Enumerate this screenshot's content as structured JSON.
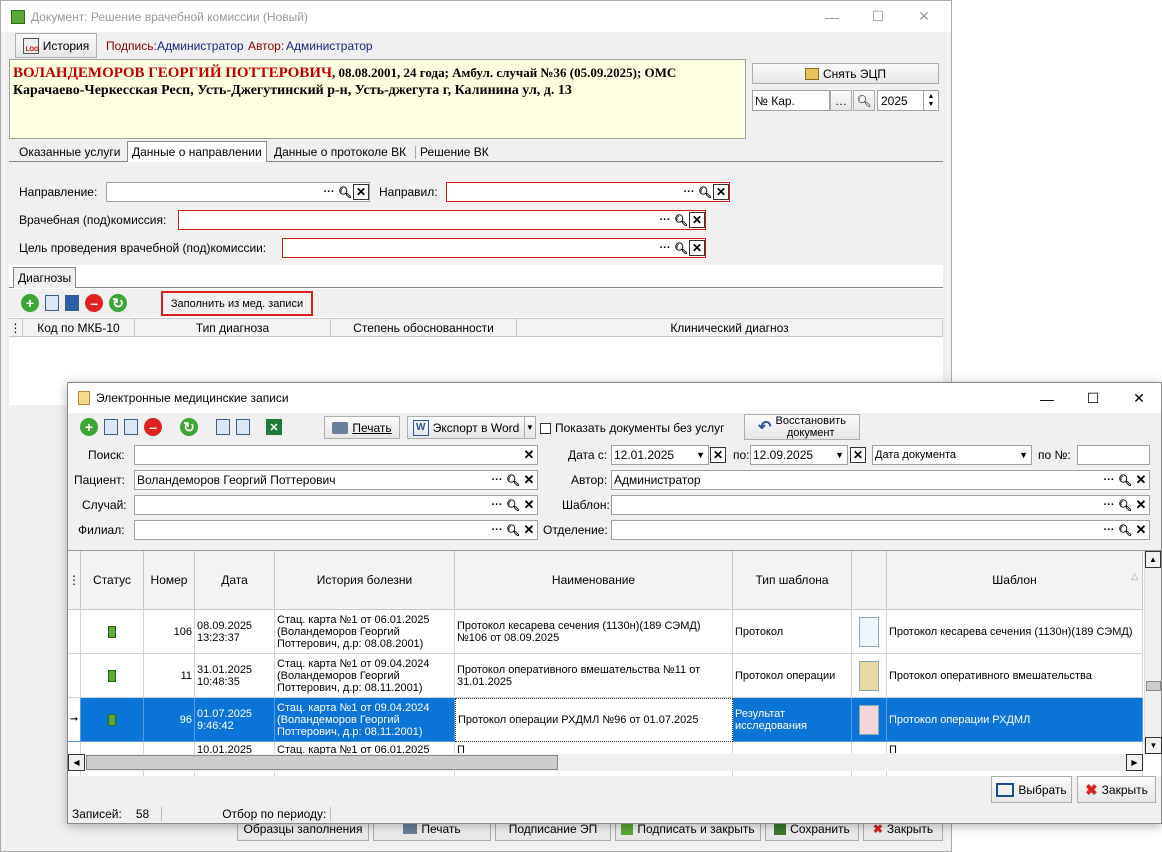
{
  "main_window": {
    "title": "Документ: Решение врачебной комиссии (Новый)",
    "history_button": "История",
    "signature_label": "Подпись:",
    "signature_value": "Администратор",
    "author_label": "Автор:",
    "author_value": "Администратор",
    "patient_name": "ВОЛАНДЕМОРОВ ГЕОРГИЙ ПОТТЕРОВИЧ",
    "patient_info": ", 08.08.2001, 24 года; Амбул. случай №36 (05.09.2025); ОМС",
    "patient_address": "Карачаево-Черкесская Респ, Усть-Джегутинский р-н, Усть-джегута г, Калинина ул, д. 13",
    "remove_ecp_button": "Снять ЭЦП",
    "card_number_placeholder": "№ Кар.",
    "year_value": "2025",
    "tabs": [
      "Оказанные услуги",
      "Данные о направлении",
      "Данные о протоколе ВК",
      "Решение ВК"
    ],
    "direction_label": "Направление:",
    "directed_by_label": "Направил:",
    "commission_label": "Врачебная (под)комиссия:",
    "purpose_label": "Цель проведения врачебной (под)комиссии:",
    "diagnoses_tab": "Диагнозы",
    "fill_from_record_button": "Заполнить из мед. записи",
    "diag_columns": [
      "Код по МКБ-10",
      "Тип диагноза",
      "Степень обоснованности",
      "Клинический диагноз"
    ],
    "bottom_buttons": [
      "Образцы заполнения",
      "Печать",
      "Подписание ЭП",
      "Подписать и закрыть",
      "Сохранить",
      "Закрыть"
    ]
  },
  "emr_dialog": {
    "title": "Электронные медицинские записи",
    "print_button": "Печать",
    "export_word_button": "Экспорт в Word",
    "show_without_services_label": "Показать документы без услуг",
    "restore_button_line1": "Восстановить",
    "restore_button_line2": "документ",
    "search_label": "Поиск:",
    "date_from_label": "Дата с:",
    "date_from_value": "12.01.2025",
    "date_to_label": "по:",
    "date_to_value": "12.09.2025",
    "date_type_value": "Дата документа",
    "number_label": "по №:",
    "patient_label": "Пациент:",
    "patient_value": "Воландеморов Георгий Поттерович",
    "author_label": "Автор:",
    "author_value": "Администратор",
    "case_label": "Случай:",
    "template_label": "Шаблон:",
    "branch_label": "Филиал:",
    "department_label": "Отделение:",
    "columns": [
      "Статус",
      "Номер",
      "Дата",
      "История болезни",
      "Наименование",
      "Тип шаблона",
      "",
      "Шаблон"
    ],
    "rows": [
      {
        "number": "106",
        "date": "08.09.2025",
        "time": "13:23:37",
        "history1": "Стац. карта №1 от 06.01.2025",
        "history2": "(Воландеморов Георгий",
        "history3": "Поттерович, д.р: 08.08.2001)",
        "name": "Протокол кесарева сечения (1130н)(189 СЭМД) №106 от 08.09.2025",
        "template_type": "Протокол",
        "template": "Протокол кесарева сечения (1130н)(189 СЭМД)"
      },
      {
        "number": "11",
        "date": "31.01.2025",
        "time": "10:48:35",
        "history1": "Стац. карта №1 от 09.04.2024",
        "history2": "(Воландеморов Георгий",
        "history3": "Поттерович, д.р: 08.11.2001)",
        "name": "Протокол оперативного вмешательства №11 от 31.01.2025",
        "template_type": "Протокол операции",
        "template": "Протокол оперативного вмешательства"
      },
      {
        "number": "96",
        "date": "01.07.2025",
        "time": "9:46:42",
        "history1": "Стац. карта №1 от 09.04.2024",
        "history2": "(Воландеморов Георгий",
        "history3": "Поттерович, д.р: 08.11.2001)",
        "name": "Протокол операции РХДМЛ №96 от 01.07.2025",
        "template_type": "Результат исследования",
        "template": "Протокол операции РХДМЛ"
      },
      {
        "number": "",
        "date": "10.01.2025",
        "time": "",
        "history1": "Стац. карта №1 от 06.01.2025",
        "history2": "",
        "history3": "",
        "name": "П",
        "template_type": "",
        "template": "П"
      }
    ],
    "select_button": "Выбрать",
    "close_button": "Закрыть",
    "records_label": "Записей:",
    "records_count": "58",
    "period_filter_label": "Отбор по периоду:"
  }
}
